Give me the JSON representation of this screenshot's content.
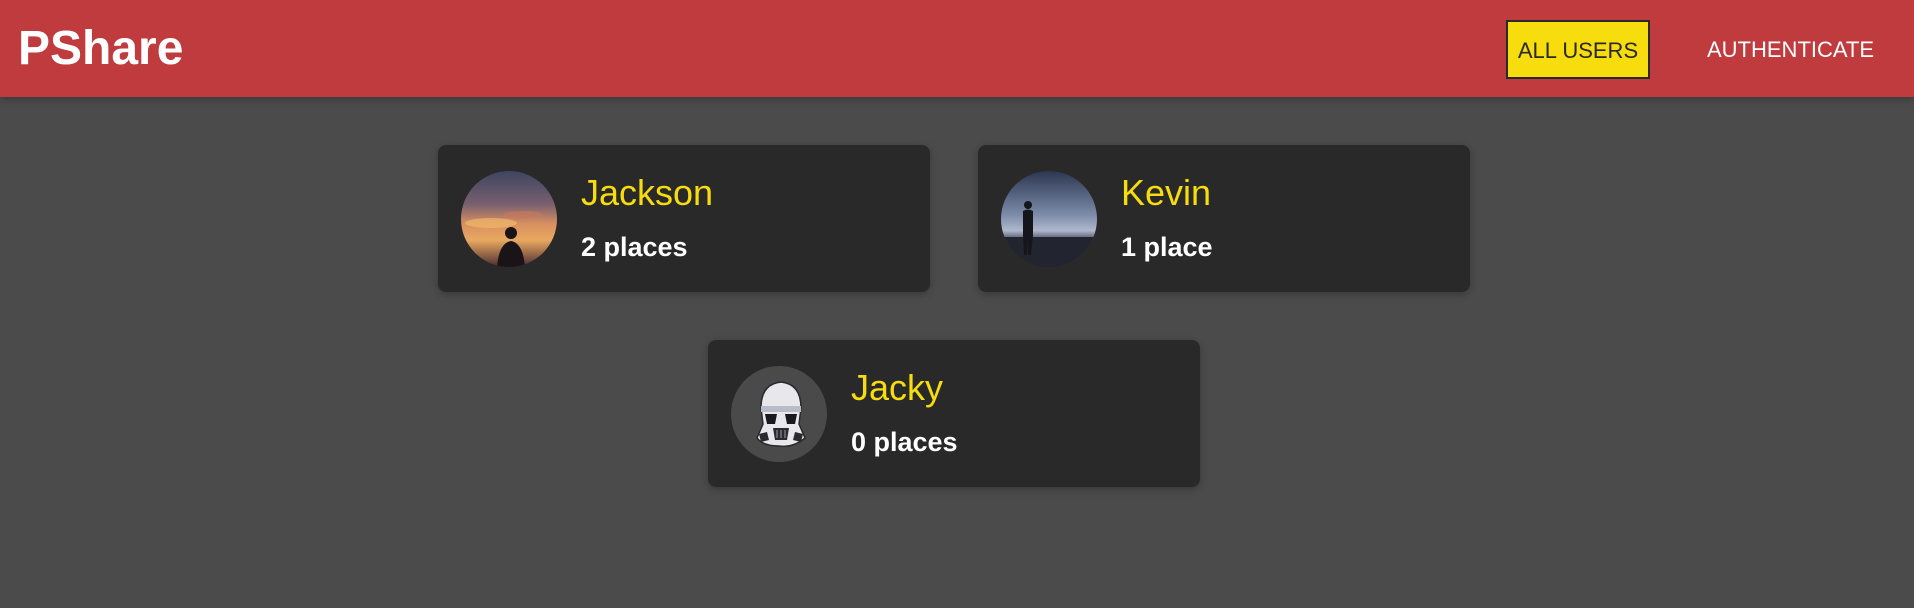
{
  "header": {
    "logo": "PShare",
    "nav": {
      "all_users": "ALL USERS",
      "authenticate": "AUTHENTICATE"
    }
  },
  "users": [
    {
      "name": "Jackson",
      "places": "2 places"
    },
    {
      "name": "Kevin",
      "places": "1 place"
    },
    {
      "name": "Jacky",
      "places": "0 places"
    }
  ],
  "colors": {
    "header_bg": "#bf3b3e",
    "page_bg": "#4b4b4b",
    "card_bg": "#292929",
    "accent_yellow": "#f7dc0e",
    "text_white": "#ffffff"
  }
}
